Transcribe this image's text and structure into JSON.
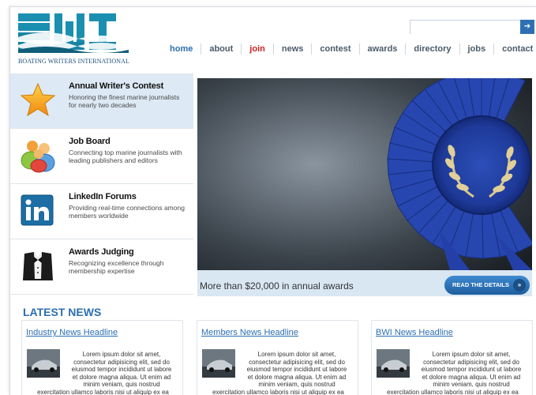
{
  "logo": {
    "text": "BOATING WRITERS INTERNATIONAL"
  },
  "search": {
    "placeholder": "",
    "button_glyph": "➔"
  },
  "nav": [
    "home",
    "about",
    "join",
    "news",
    "contest",
    "awards",
    "directory",
    "jobs",
    "contact"
  ],
  "features": [
    {
      "title": "Annual Writer's Contest",
      "desc": "Honoring the finest marine journalists for nearly two decades",
      "icon": "star-icon"
    },
    {
      "title": "Job Board",
      "desc": "Connecting top marine journalists with leading publishers and editors",
      "icon": "people-icon"
    },
    {
      "title": "LinkedIn Forums",
      "desc": "Providing real-time connections among members worldwide",
      "icon": "linkedin-icon"
    },
    {
      "title": "Awards Judging",
      "desc": "Recognizing excellence through membership expertise",
      "icon": "tuxedo-icon"
    }
  ],
  "hero": {
    "caption": "More than $20,000 in annual awards",
    "button_label": "READ THE DETAILS",
    "button_arrow": "»"
  },
  "latest_news": {
    "title": "LATEST NEWS",
    "items": [
      {
        "headline": "Industry News Headline",
        "body_lines": [
          "Lorem ipsum dolor sit amet,",
          "consectetur adipisicing elit, sed do",
          "eiusmod tempor incididunt ut labore",
          "et dolore magna aliqua. Ut enim ad",
          "minim veniam, quis nostrud"
        ],
        "tail": "exercitation ullamco laboris nisi ut aliquip ex ea"
      },
      {
        "headline": "Members News Headline",
        "body_lines": [
          "Lorem ipsum dolor sit amet,",
          "consectetur adipisicing elit, sed do",
          "eiusmod tempor incididunt ut labore",
          "et dolore magna aliqua. Ut enim ad",
          "minim veniam, quis nostrud"
        ],
        "tail": "exercitation ullamco laboris nisi ut aliquip ex ea"
      },
      {
        "headline": "BWI News Headline",
        "body_lines": [
          "Lorem ipsum dolor sit amet,",
          "consectetur adipisicing elit, sed do",
          "eiusmod tempor incididunt ut labore",
          "et dolore magna aliqua. Ut enim ad",
          "minim veniam, quis nostrud"
        ],
        "tail": "exercitation ullamco laboris nisi ut aliquip ex ea"
      }
    ]
  },
  "colors": {
    "brand_blue": "#2c6fb0",
    "teal": "#1a8aa6",
    "join_red": "#c8201f",
    "panel_blue": "#dde9f4"
  }
}
